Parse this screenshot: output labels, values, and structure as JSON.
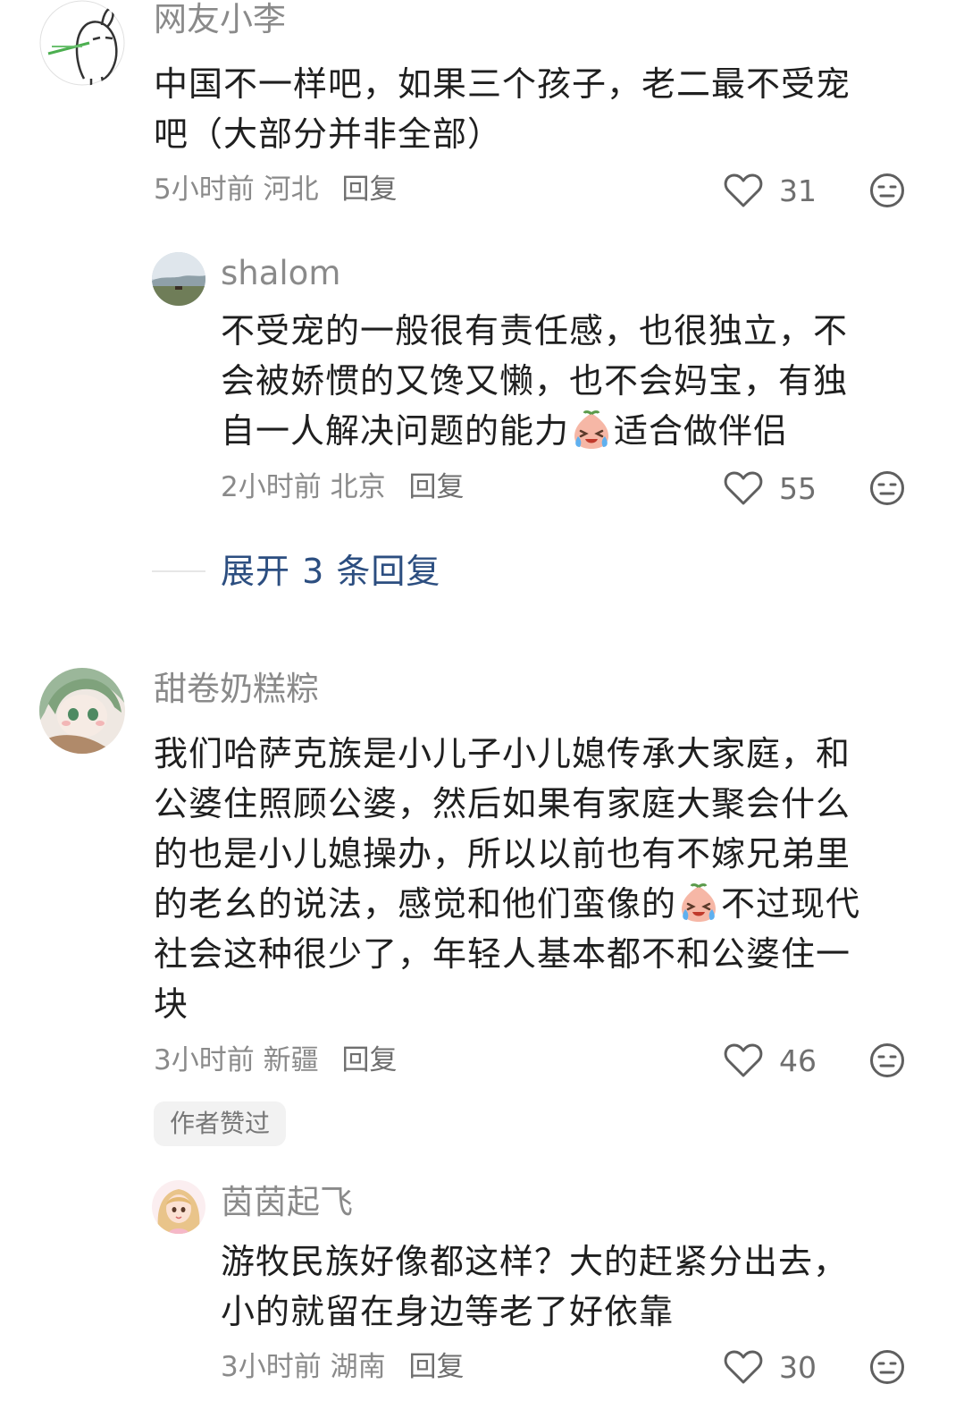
{
  "comments": [
    {
      "username": "网友小李",
      "text_lines": [
        "中国不一样吧，如果三个孩子，老二最不受宠",
        "吧（大部分并非全部）"
      ],
      "time": "5小时前",
      "location": "河北",
      "reply_label": "回复",
      "likes": "31",
      "avatar_icon": "bunny-doodle-avatar",
      "replies": [
        {
          "username": "shalom",
          "text_lines": [
            "不受宠的一般很有责任感，也很独立，不",
            "会被娇惯的又馋又懒，也不会妈宝，有独",
            "自一人解决问题的能力",
            "适合做伴侣"
          ],
          "emoji": "crying-laughing-peach-emoji",
          "time": "2小时前",
          "location": "北京",
          "reply_label": "回复",
          "likes": "55",
          "avatar_icon": "landscape-photo-avatar"
        }
      ],
      "expand_label": "展开 3 条回复"
    },
    {
      "username": "甜卷奶糕粽",
      "text_lines": [
        "我们哈萨克族是小儿子小儿媳传承大家庭，和",
        "公婆住照顾公婆，然后如果有家庭大聚会什么",
        "的也是小儿媳操办，所以以前也有不嫁兄弟里",
        "的老幺的说法，感觉和他们蛮像的",
        "不过现代",
        "社会这种很少了，年轻人基本都不和公婆住一",
        "块"
      ],
      "emoji": "crying-laughing-peach-emoji",
      "time": "3小时前",
      "location": "新疆",
      "reply_label": "回复",
      "likes": "46",
      "badge": "作者赞过",
      "avatar_icon": "anime-girl-green-hair-avatar",
      "replies": [
        {
          "username": "茵茵起飞",
          "text_lines": [
            "游牧民族好像都这样？大的赶紧分出去，",
            "小的就留在身边等老了好依靠"
          ],
          "time": "3小时前",
          "location": "湖南",
          "reply_label": "回复",
          "likes": "30",
          "avatar_icon": "cartoon-blonde-girl-avatar"
        }
      ]
    }
  ],
  "icons": {
    "like": "heart-outline-icon",
    "dislike": "meh-face-icon"
  },
  "colors": {
    "username": "#8a8a8a",
    "text": "#1f1f1f",
    "expand_link": "#2c4e80",
    "badge_bg": "#f2f2f2"
  }
}
